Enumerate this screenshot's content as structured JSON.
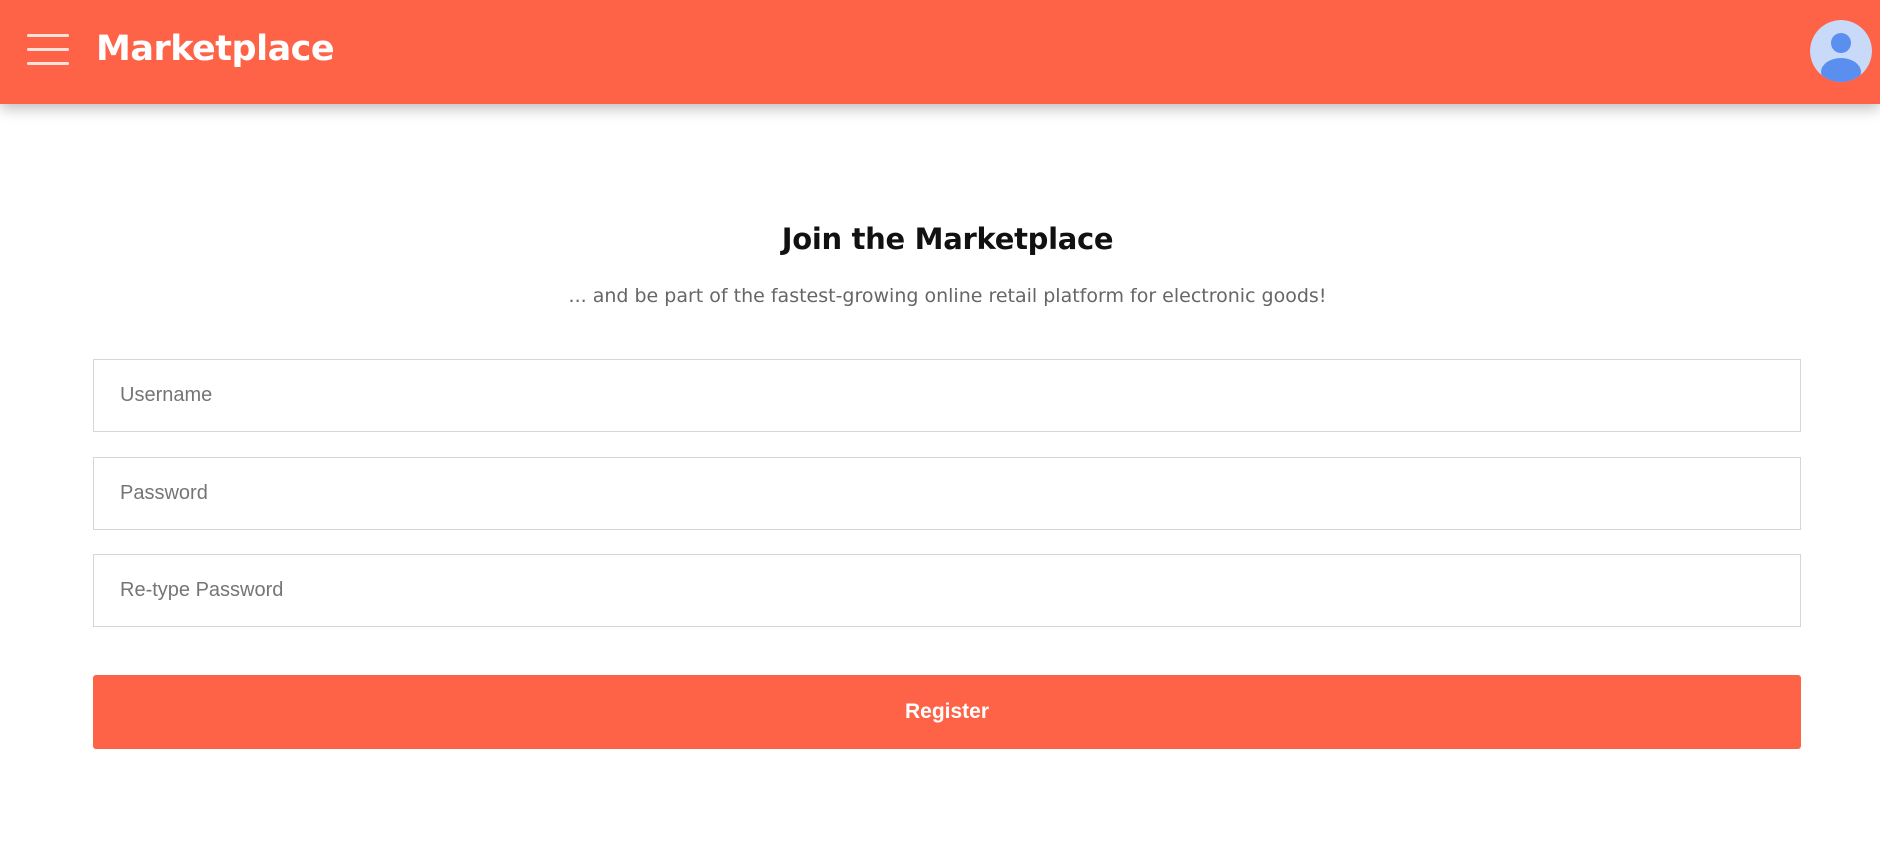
{
  "theme": {
    "accent": "#ff6347",
    "avatar_bg": "#c8daf8",
    "avatar_fg": "#5a8ff0"
  },
  "header": {
    "menu_icon": "hamburger-menu-icon",
    "title": "Marketplace",
    "avatar_icon": "user-avatar-icon"
  },
  "main": {
    "heading": "Join the Marketplace",
    "subheading": "... and be part of the fastest-growing online retail platform for electronic goods!",
    "fields": {
      "username": {
        "placeholder": "Username",
        "value": ""
      },
      "password": {
        "placeholder": "Password",
        "value": ""
      },
      "retype_password": {
        "placeholder": "Re-type Password",
        "value": ""
      }
    },
    "register_label": "Register"
  }
}
